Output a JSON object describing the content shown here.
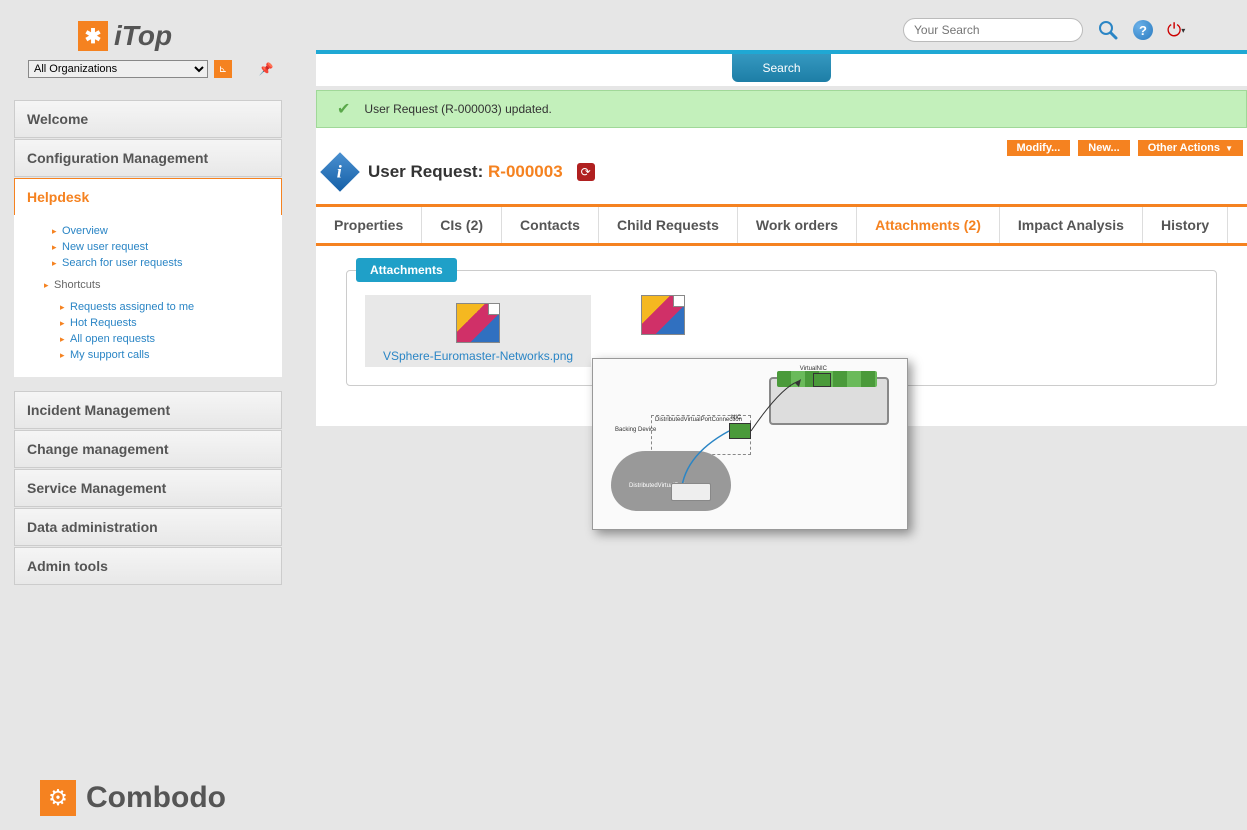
{
  "brand": {
    "name": "iTop",
    "footer": "Combodo"
  },
  "topbar": {
    "search_placeholder": "Your Search",
    "org_selected": "All Organizations"
  },
  "sidebar": {
    "items": [
      {
        "label": "Welcome",
        "active": false
      },
      {
        "label": "Configuration Management",
        "active": false
      },
      {
        "label": "Helpdesk",
        "active": true
      },
      {
        "label": "Incident Management",
        "active": false
      },
      {
        "label": "Change management",
        "active": false
      },
      {
        "label": "Service Management",
        "active": false
      },
      {
        "label": "Data administration",
        "active": false
      },
      {
        "label": "Admin tools",
        "active": false
      }
    ],
    "helpdesk_sub": {
      "group1": [
        {
          "label": "Overview"
        },
        {
          "label": "New user request"
        },
        {
          "label": "Search for user requests"
        }
      ],
      "shortcuts_label": "Shortcuts",
      "group2": [
        {
          "label": "Requests assigned to me"
        },
        {
          "label": "Hot Requests"
        },
        {
          "label": "All open requests"
        },
        {
          "label": "My support calls"
        }
      ]
    }
  },
  "main": {
    "search_tab": "Search",
    "notification": "User Request (R-000003) updated.",
    "actions": {
      "modify": "Modify...",
      "new": "New...",
      "other": "Other Actions"
    },
    "title_prefix": "User Request:",
    "title_ref": "R-000003",
    "tabs": [
      {
        "label": "Properties",
        "active": false
      },
      {
        "label": "CIs (2)",
        "active": false
      },
      {
        "label": "Contacts",
        "active": false
      },
      {
        "label": "Child Requests",
        "active": false
      },
      {
        "label": "Work orders",
        "active": false
      },
      {
        "label": "Attachments (2)",
        "active": true
      },
      {
        "label": "Impact Analysis",
        "active": false
      },
      {
        "label": "History",
        "active": false
      }
    ],
    "attachments": {
      "fieldset_label": "Attachments",
      "files": [
        {
          "name": "VSphere-Euromaster-Networks.png"
        },
        {
          "name": ""
        }
      ]
    },
    "preview_labels": {
      "virtualnic": "VirtualNIC",
      "nic": "NIC",
      "dvpc": "DistributedVirtualPortConnection",
      "backing": "Backing Device",
      "dvpg": "DistributedVirtualPortgroup"
    }
  }
}
